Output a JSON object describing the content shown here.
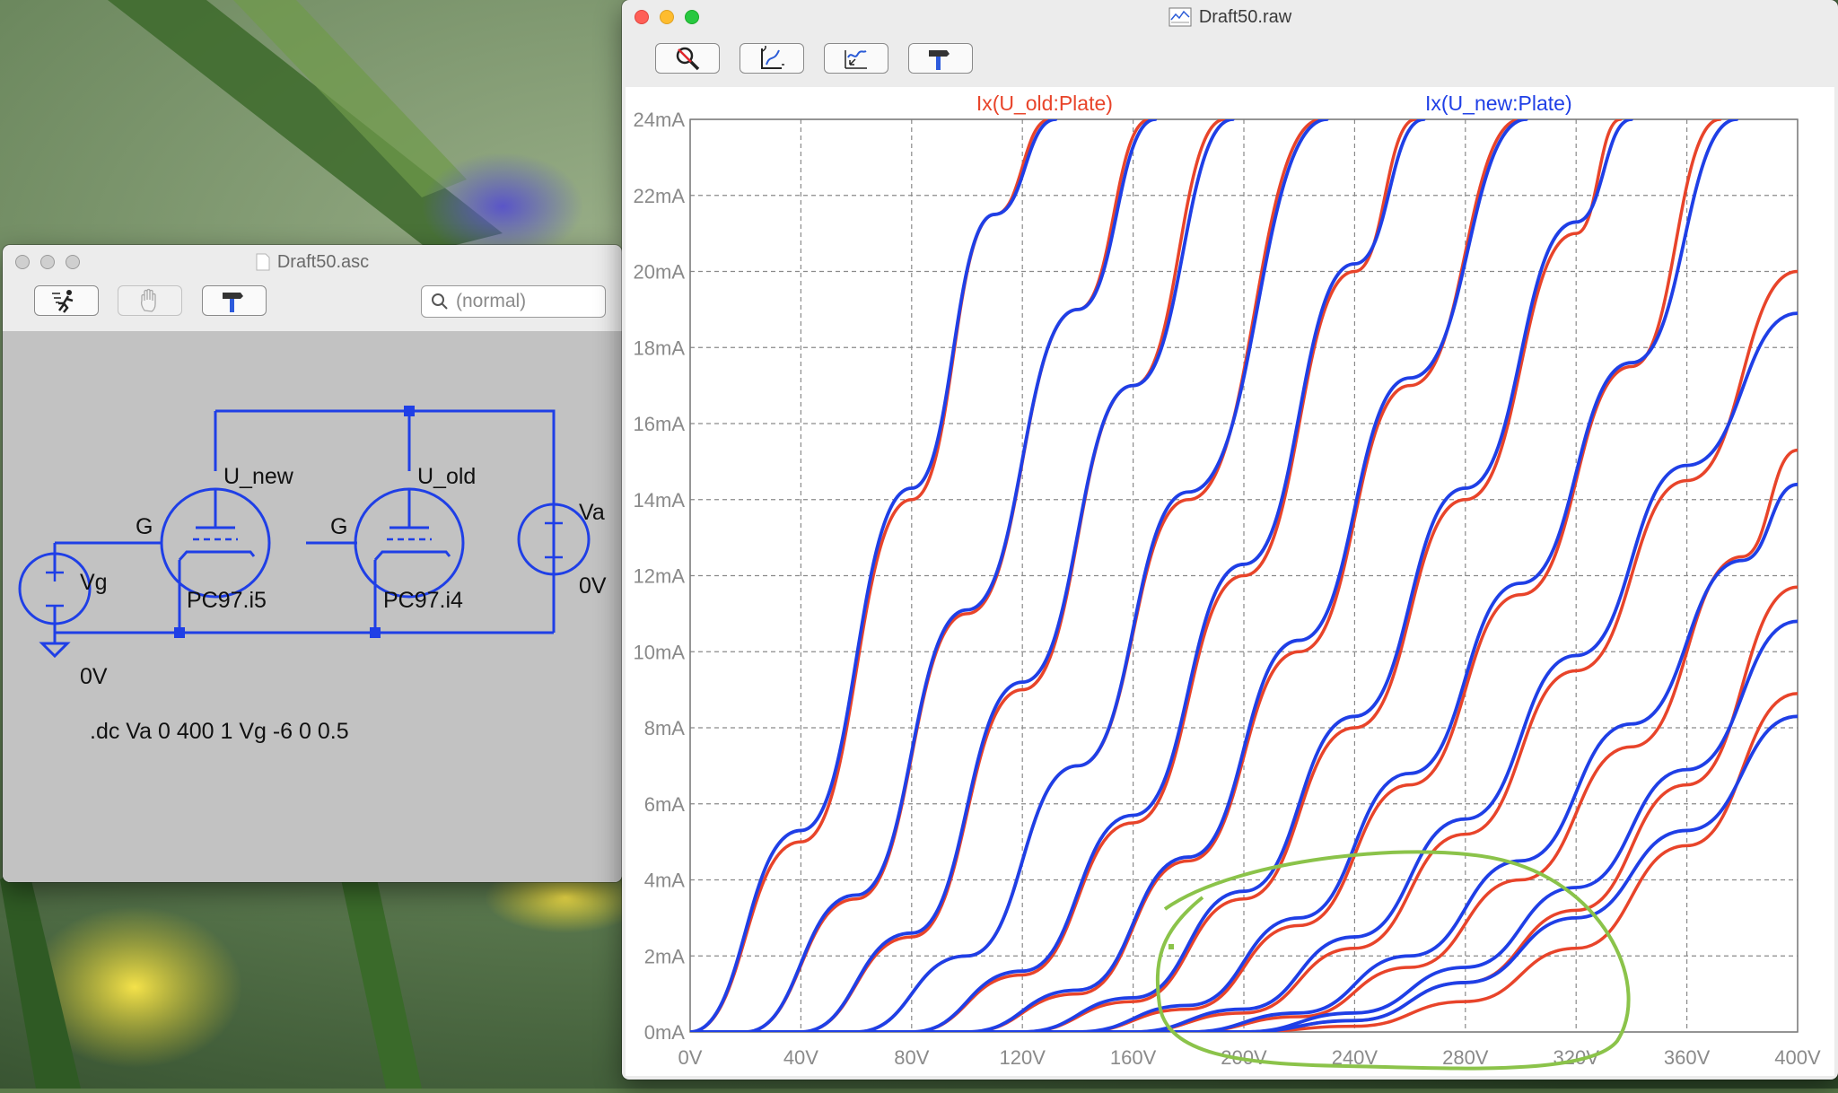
{
  "plot_window": {
    "title": "Draft50.raw",
    "toolbar": [
      "zoom-cancel",
      "autorange",
      "waveform-marker",
      "hammer"
    ],
    "trace_old_label": "Ix(U_old:Plate)",
    "trace_new_label": "Ix(U_new:Plate)",
    "colors": {
      "old": "#e8442a",
      "new": "#1f3fe6"
    }
  },
  "schematic_window": {
    "title": "Draft50.asc",
    "search_placeholder": "(normal)",
    "labels": {
      "u_new": "U_new",
      "u_old": "U_old",
      "g1": "G",
      "g2": "G",
      "va": "Va",
      "va_value": "0V",
      "vg": "Vg",
      "vg_value": "0V",
      "model_new": "PC97.i5",
      "model_old": "PC97.i4",
      "directive": ".dc Va 0 400 1 Vg -6 0 0.5"
    }
  },
  "chart_data": {
    "type": "line",
    "x_label_ticks": [
      "0V",
      "40V",
      "80V",
      "120V",
      "160V",
      "200V",
      "240V",
      "280V",
      "320V",
      "360V",
      "400V"
    ],
    "y_label_ticks": [
      "0mA",
      "2mA",
      "4mA",
      "6mA",
      "8mA",
      "10mA",
      "12mA",
      "14mA",
      "16mA",
      "18mA",
      "20mA",
      "22mA",
      "24mA"
    ],
    "xlim": [
      0,
      400
    ],
    "ylim": [
      0,
      24
    ],
    "grid": true,
    "series": [
      {
        "name": "Ix(U_old:Plate)",
        "color": "#e8442a",
        "curves": [
          {
            "vg": 0,
            "x": [
              0,
              40,
              80,
              110,
              130
            ],
            "y": [
              0,
              5,
              14,
              21.5,
              24
            ]
          },
          {
            "vg": -0.5,
            "x": [
              20,
              60,
              100,
              140,
              166
            ],
            "y": [
              0,
              3.5,
              11,
              19,
              24
            ]
          },
          {
            "vg": -1.0,
            "x": [
              40,
              80,
              120,
              160,
              193
            ],
            "y": [
              0,
              2.5,
              9,
              17,
              24
            ]
          },
          {
            "vg": -1.5,
            "x": [
              60,
              100,
              140,
              180,
              228
            ],
            "y": [
              0,
              2,
              7,
              14,
              24
            ]
          },
          {
            "vg": -2.0,
            "x": [
              80,
              120,
              160,
              200,
              240,
              262
            ],
            "y": [
              0,
              1.5,
              5.5,
              12,
              20,
              24
            ]
          },
          {
            "vg": -2.5,
            "x": [
              100,
              140,
              180,
              220,
              260,
              300
            ],
            "y": [
              0,
              1,
              4.5,
              10,
              17,
              24
            ]
          },
          {
            "vg": -3.0,
            "x": [
              120,
              160,
              200,
              240,
              280,
              320,
              336
            ],
            "y": [
              0,
              0.8,
              3.5,
              8,
              14,
              21,
              24
            ]
          },
          {
            "vg": -3.5,
            "x": [
              140,
              180,
              220,
              260,
              300,
              340,
              372
            ],
            "y": [
              0,
              0.6,
              2.8,
              6.5,
              11.5,
              17.5,
              24
            ]
          },
          {
            "vg": -4.0,
            "x": [
              160,
              200,
              240,
              280,
              320,
              360,
              400
            ],
            "y": [
              0,
              0.5,
              2.2,
              5.2,
              9.5,
              14.5,
              20
            ]
          },
          {
            "vg": -4.5,
            "x": [
              180,
              220,
              260,
              300,
              340,
              380,
              400
            ],
            "y": [
              0,
              0.4,
              1.7,
              4,
              7.5,
              12.5,
              15.3
            ]
          },
          {
            "vg": -5.0,
            "x": [
              200,
              240,
              280,
              320,
              360,
              400
            ],
            "y": [
              0,
              0.3,
              1.3,
              3.2,
              6.5,
              11.7
            ]
          },
          {
            "vg": -5.5,
            "x": [
              200,
              240,
              280,
              320,
              360,
              400
            ],
            "y": [
              0,
              0.15,
              0.8,
              2.2,
              4.9,
              8.9
            ]
          }
        ]
      },
      {
        "name": "Ix(U_new:Plate)",
        "color": "#1f3fe6",
        "curves": [
          {
            "vg": 0,
            "x": [
              0,
              40,
              80,
              110,
              132
            ],
            "y": [
              0,
              5.3,
              14.3,
              21.5,
              24
            ]
          },
          {
            "vg": -0.5,
            "x": [
              20,
              60,
              100,
              140,
              168
            ],
            "y": [
              0,
              3.6,
              11.1,
              19,
              24
            ]
          },
          {
            "vg": -1.0,
            "x": [
              40,
              80,
              120,
              160,
              196
            ],
            "y": [
              0,
              2.6,
              9.2,
              17,
              24
            ]
          },
          {
            "vg": -1.5,
            "x": [
              60,
              100,
              140,
              180,
              230
            ],
            "y": [
              0,
              2,
              7,
              14.2,
              24
            ]
          },
          {
            "vg": -2.0,
            "x": [
              80,
              120,
              160,
              200,
              240,
              265
            ],
            "y": [
              0,
              1.6,
              5.7,
              12.3,
              20.2,
              24
            ]
          },
          {
            "vg": -2.5,
            "x": [
              100,
              140,
              180,
              220,
              260,
              302
            ],
            "y": [
              0,
              1.1,
              4.6,
              10.3,
              17.2,
              24
            ]
          },
          {
            "vg": -3.0,
            "x": [
              120,
              160,
              200,
              240,
              280,
              320,
              340
            ],
            "y": [
              0,
              0.9,
              3.7,
              8.3,
              14.3,
              21.3,
              24
            ]
          },
          {
            "vg": -3.5,
            "x": [
              140,
              180,
              220,
              260,
              300,
              340,
              378
            ],
            "y": [
              0,
              0.7,
              3,
              6.8,
              11.8,
              17.6,
              24
            ]
          },
          {
            "vg": -4.0,
            "x": [
              160,
              200,
              240,
              280,
              320,
              360,
              400
            ],
            "y": [
              0,
              0.6,
              2.5,
              5.6,
              9.9,
              14.9,
              18.9
            ]
          },
          {
            "vg": -4.5,
            "x": [
              180,
              220,
              260,
              300,
              340,
              380,
              400
            ],
            "y": [
              0,
              0.5,
              2,
              4.5,
              8.1,
              12.4,
              14.4
            ]
          },
          {
            "vg": -5.0,
            "x": [
              200,
              240,
              280,
              320,
              360,
              400
            ],
            "y": [
              0,
              0.5,
              1.7,
              3.8,
              6.9,
              10.8
            ]
          },
          {
            "vg": -5.5,
            "x": [
              200,
              240,
              280,
              320,
              360,
              400
            ],
            "y": [
              0,
              0.3,
              1.3,
              3,
              5.3,
              8.3
            ]
          }
        ]
      }
    ]
  }
}
